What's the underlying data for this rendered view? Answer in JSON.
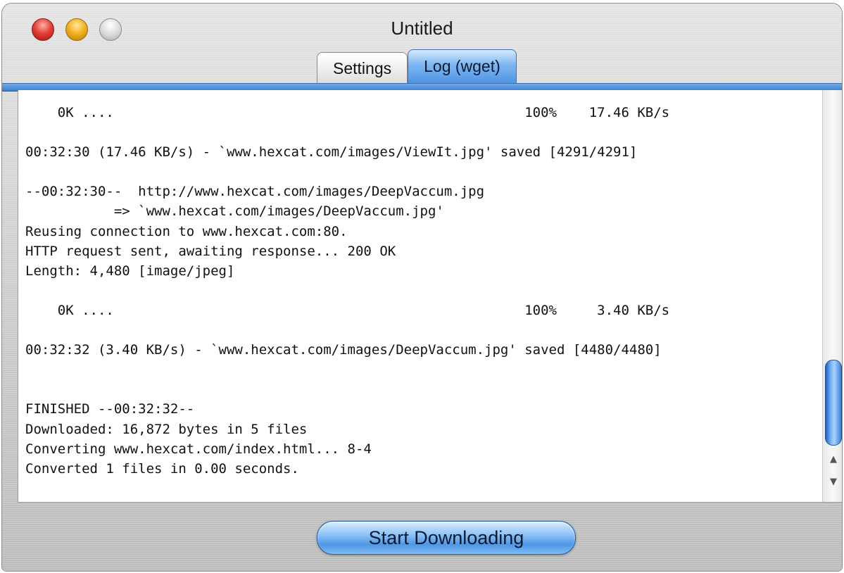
{
  "window": {
    "title": "Untitled"
  },
  "tabs": [
    {
      "label": "Settings",
      "active": false
    },
    {
      "label": "Log (wget)",
      "active": true
    }
  ],
  "log": {
    "lines": [
      "    0K ....                                                   100%    17.46 KB/s",
      "",
      "00:32:30 (17.46 KB/s) - `www.hexcat.com/images/ViewIt.jpg' saved [4291/4291]",
      "",
      "--00:32:30--  http://www.hexcat.com/images/DeepVaccum.jpg",
      "           => `www.hexcat.com/images/DeepVaccum.jpg'",
      "Reusing connection to www.hexcat.com:80.",
      "HTTP request sent, awaiting response... 200 OK",
      "Length: 4,480 [image/jpeg]",
      "",
      "    0K ....                                                   100%     3.40 KB/s",
      "",
      "00:32:32 (3.40 KB/s) - `www.hexcat.com/images/DeepVaccum.jpg' saved [4480/4480]",
      "",
      "",
      "FINISHED --00:32:32--",
      "Downloaded: 16,872 bytes in 5 files",
      "Converting www.hexcat.com/index.html... 8-4",
      "Converted 1 files in 0.00 seconds."
    ]
  },
  "buttons": {
    "start_label": "Start Downloading"
  },
  "icons": {
    "close": "close-icon",
    "minimize": "minimize-icon",
    "zoom": "zoom-icon",
    "scroll_up": "scroll-up-arrow-icon",
    "scroll_down": "scroll-down-arrow-icon"
  },
  "colors": {
    "accent_blue": "#4f95e2",
    "close_red": "#e2423a",
    "minimize_yellow": "#f3b324"
  },
  "glyphs": {
    "up": "▲",
    "down": "▼"
  }
}
